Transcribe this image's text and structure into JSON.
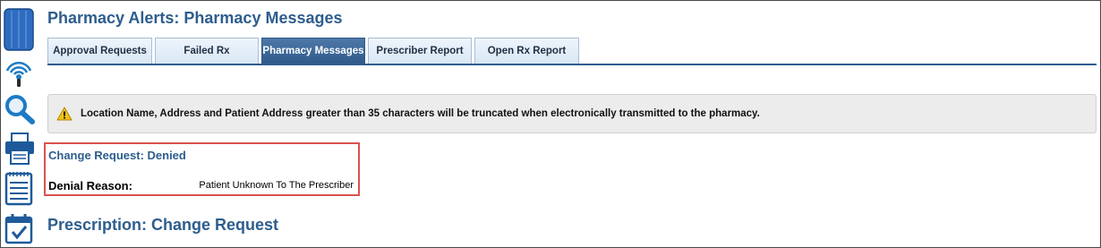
{
  "header": {
    "title": "Pharmacy Alerts: Pharmacy Messages"
  },
  "tabs": [
    {
      "label": "Approval Requests"
    },
    {
      "label": "Failed Rx"
    },
    {
      "label": "Pharmacy Messages",
      "active": true
    },
    {
      "label": "Prescriber Report"
    },
    {
      "label": "Open Rx Report"
    }
  ],
  "banner": {
    "icon": "warning-icon",
    "message": "Location Name, Address and Patient Address greater than 35 characters will be truncated when electronically transmitted to the pharmacy."
  },
  "change_request": {
    "status": "Change Request: Denied",
    "reason_label": "Denial Reason:",
    "reason_value": "Patient Unknown To The Prescriber"
  },
  "section": {
    "title": "Prescription: Change Request"
  },
  "sidebar": {
    "icons": [
      "grid-icon",
      "broadcast-icon",
      "search-icon",
      "printer-icon",
      "notepad-icon",
      "calendar-check-icon"
    ]
  },
  "colors": {
    "accent": "#2e5d8e",
    "active_tab": "#3a6696",
    "highlight_border": "#d9534f",
    "banner_bg": "#ececec",
    "warning_yellow": "#f2c21b"
  }
}
